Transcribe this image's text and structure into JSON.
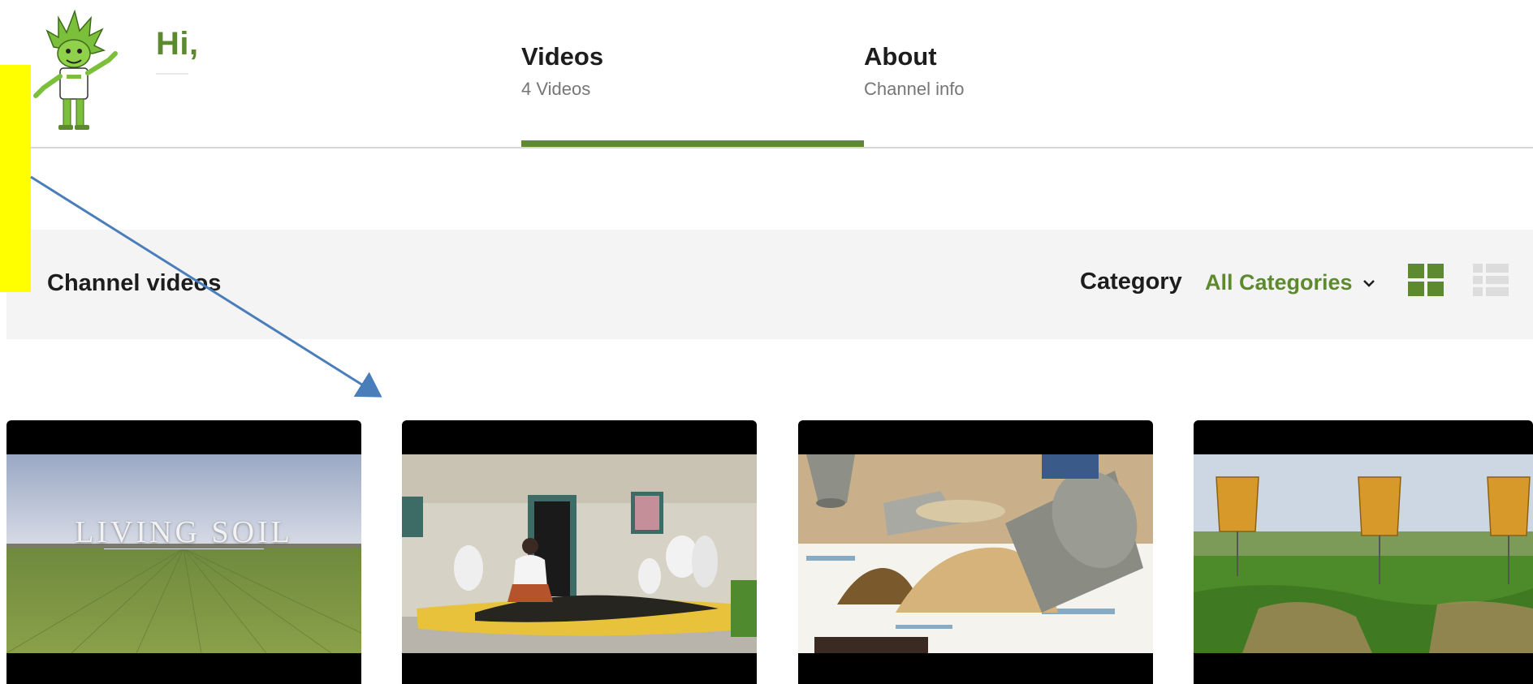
{
  "header": {
    "greeting": "Hi,"
  },
  "tabs": [
    {
      "title": "Videos",
      "subtitle": "4 Videos",
      "active": true
    },
    {
      "title": "About",
      "subtitle": "Channel info",
      "active": false
    }
  ],
  "toolbar": {
    "title": "Channel videos",
    "category_label": "Category",
    "category_value": "All Categories"
  },
  "videos": [
    {
      "thumbnail_text": "LIVING SOIL"
    }
  ],
  "colors": {
    "brand_green": "#5e8a2f",
    "highlight": "#ffff00",
    "arrow": "#4a7ebb"
  },
  "icons": {
    "mascot": "cartoon-mascot",
    "dropdown": "chevron-down-icon",
    "grid_view": "grid-view-icon",
    "list_view": "list-view-icon"
  }
}
